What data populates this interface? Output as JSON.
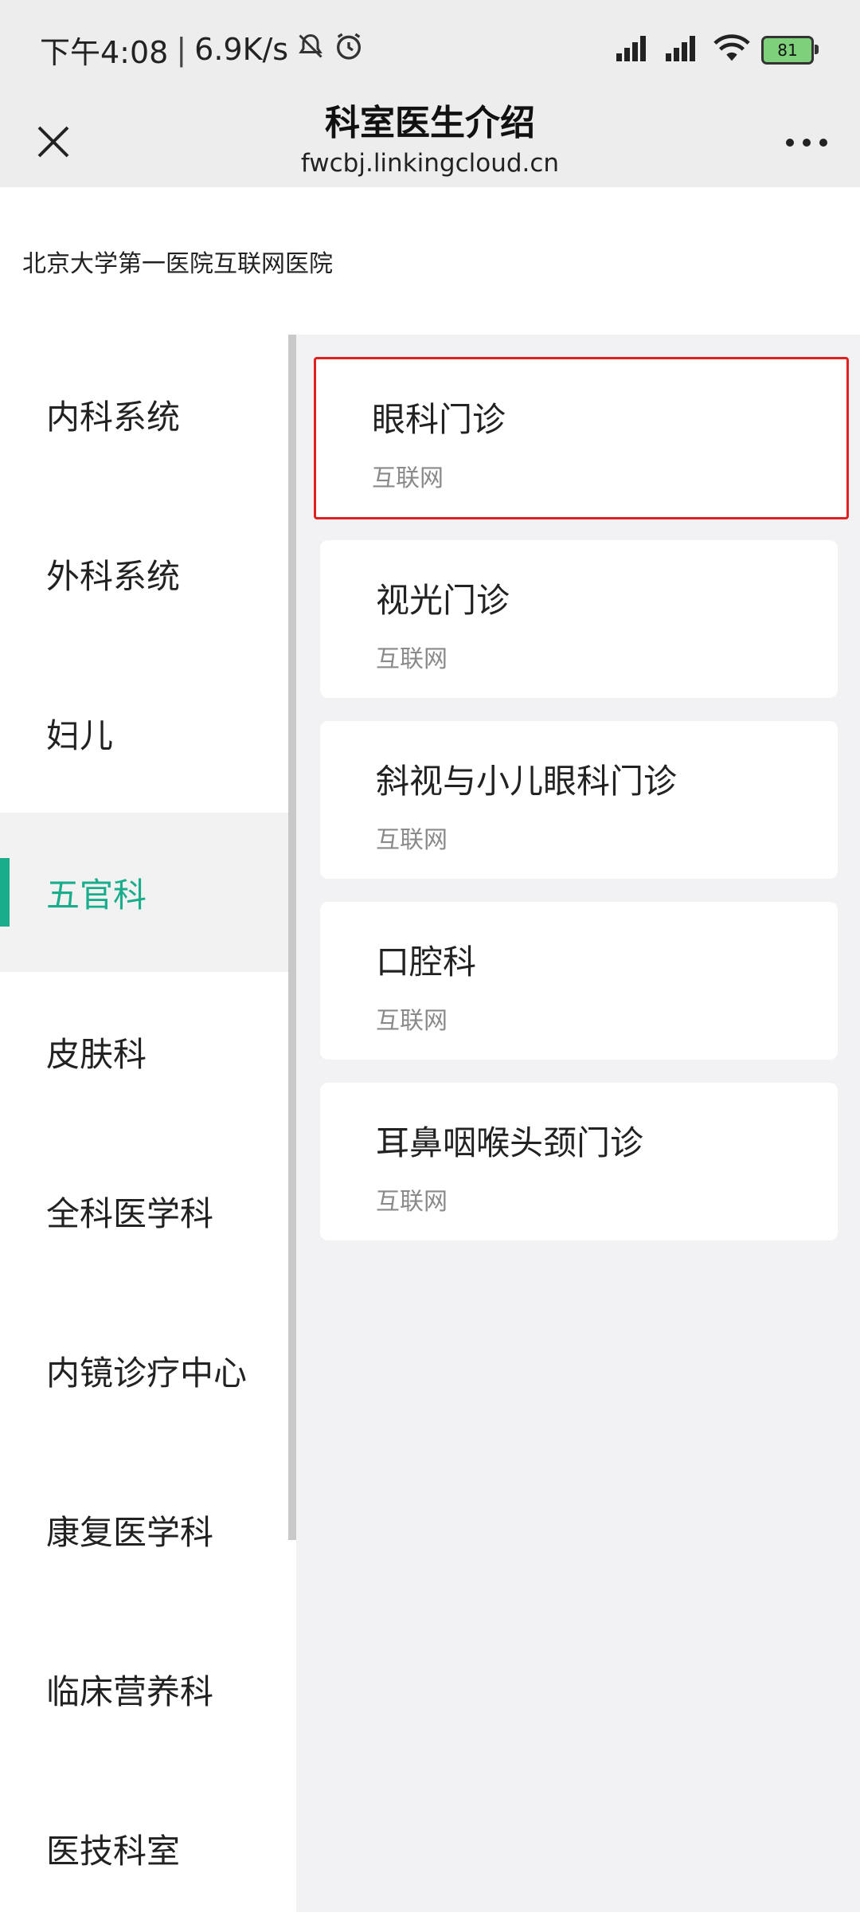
{
  "status_bar": {
    "time": "下午4:08",
    "network_speed": "6.9K/s",
    "battery": "81",
    "icons": [
      "mute-icon",
      "alarm-icon",
      "signal-icon",
      "signal-icon",
      "wifi-icon",
      "battery-icon"
    ]
  },
  "title_bar": {
    "title": "科室医生介绍",
    "url": "fwcbj.linkingcloud.cn",
    "close_icon": "close-icon",
    "more_icon": "more-icon"
  },
  "hospital": {
    "name": "北京大学第一医院互联网医院"
  },
  "sidebar": {
    "active_index": 3,
    "accent": "#1aad8c",
    "items": [
      {
        "label": "内科系统"
      },
      {
        "label": "外科系统"
      },
      {
        "label": "妇儿"
      },
      {
        "label": "五官科"
      },
      {
        "label": "皮肤科"
      },
      {
        "label": "全科医学科"
      },
      {
        "label": "内镜诊疗中心"
      },
      {
        "label": "康复医学科"
      },
      {
        "label": "临床营养科"
      },
      {
        "label": "医技科室"
      }
    ]
  },
  "departments": [
    {
      "name": "眼科门诊",
      "subtitle": "互联网"
    },
    {
      "name": "视光门诊",
      "subtitle": "互联网"
    },
    {
      "name": "斜视与小儿眼科门诊",
      "subtitle": "互联网"
    },
    {
      "name": "口腔科",
      "subtitle": "互联网"
    },
    {
      "name": "耳鼻咽喉头颈门诊",
      "subtitle": "互联网"
    }
  ]
}
